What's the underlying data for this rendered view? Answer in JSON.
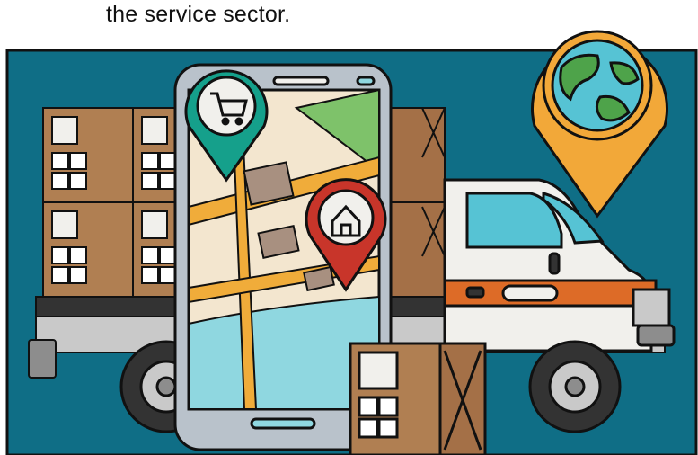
{
  "caption": {
    "text": "the service sector."
  },
  "colors": {
    "background": "#0f6e86",
    "box": "#b07f52",
    "truck_white": "#f1f0ec",
    "truck_orange": "#dd6b27",
    "pin_teal": "#15a08b",
    "pin_red": "#c8352a",
    "pin_yellow": "#f2a839",
    "globe_ocean": "#56c3d4",
    "globe_land": "#4ea34a",
    "map_road": "#f0ac3a",
    "map_water": "#8fd7e0",
    "map_park": "#7ec26a"
  },
  "illustration": {
    "subject": "delivery-truck-map",
    "icons": [
      "cart-icon",
      "home-icon",
      "globe-icon"
    ]
  }
}
